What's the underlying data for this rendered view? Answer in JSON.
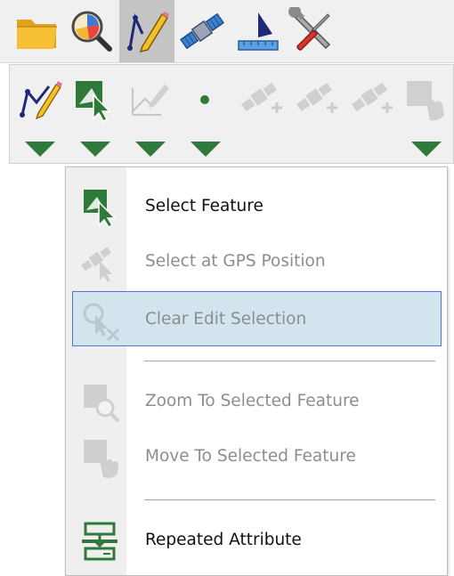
{
  "toolbar": {
    "buttons": [
      {
        "icon": "folder-icon",
        "active": false
      },
      {
        "icon": "map-search-icon",
        "active": false
      },
      {
        "icon": "edit-pencil-icon",
        "active": true
      },
      {
        "icon": "gps-satellite-icon",
        "active": false
      },
      {
        "icon": "measure-icon",
        "active": false
      },
      {
        "icon": "tools-icon",
        "active": false
      }
    ]
  },
  "edit_toolbar": {
    "buttons": [
      {
        "icon": "draw-line-icon",
        "enabled": true,
        "has_dropdown": true
      },
      {
        "icon": "select-feature-icon",
        "enabled": true,
        "has_dropdown": true
      },
      {
        "icon": "edit-vertices-icon",
        "enabled": false,
        "has_dropdown": true
      },
      {
        "icon": "point-icon",
        "enabled": true,
        "has_dropdown": true
      },
      {
        "icon": "gps-add-vertex-icon",
        "enabled": false,
        "has_dropdown": false
      },
      {
        "icon": "gps-add-stream-icon",
        "enabled": false,
        "has_dropdown": false
      },
      {
        "icon": "gps-add-stream-alt-icon",
        "enabled": false,
        "has_dropdown": false
      },
      {
        "icon": "selection-options-icon",
        "enabled": false,
        "has_dropdown": true
      }
    ]
  },
  "menu": {
    "items": [
      {
        "label": "Select Feature",
        "icon": "select-feature-icon",
        "enabled": true,
        "highlighted": false
      },
      {
        "label": "Select at GPS Position",
        "icon": "gps-select-icon",
        "enabled": false,
        "highlighted": false
      },
      {
        "label": "Clear Edit Selection",
        "icon": "clear-selection-icon",
        "enabled": false,
        "highlighted": true
      },
      {
        "label": "Zoom To Selected Feature",
        "icon": "zoom-to-selection-icon",
        "enabled": false,
        "highlighted": false
      },
      {
        "label": "Move To Selected Feature",
        "icon": "pan-to-selection-icon",
        "enabled": false,
        "highlighted": false
      },
      {
        "label": "Repeated Attribute",
        "icon": "repeated-attribute-icon",
        "enabled": true,
        "highlighted": false
      }
    ]
  },
  "colors": {
    "accent_green": "#2f7a3a",
    "highlight_bg": "#d2e5ee",
    "highlight_border": "#5c6fd6",
    "disabled_text": "#8d8d8d"
  }
}
